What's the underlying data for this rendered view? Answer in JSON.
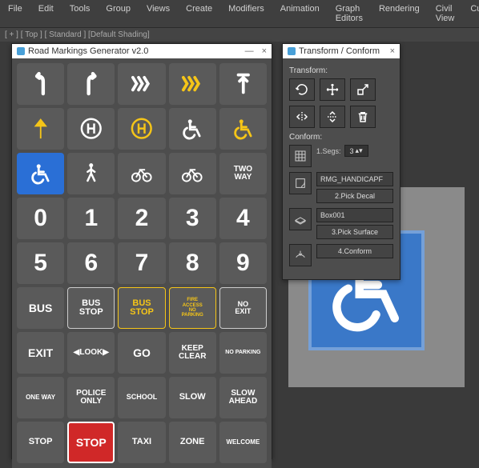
{
  "menu": {
    "items": [
      "File",
      "Edit",
      "Tools",
      "Group",
      "Views",
      "Create",
      "Modifiers",
      "Animation",
      "Graph Editors",
      "Rendering",
      "Civil View",
      "Customize"
    ]
  },
  "status_line": "[ + ] [ Top ] [ Standard ] [Default Shading]",
  "rm_panel": {
    "title": "Road Markings Generator v2.0",
    "minimize": "—",
    "close": "×",
    "tiles": [
      {
        "name": "arrow-left-turn",
        "kind": "svg",
        "svg": "arrL",
        "cls": ""
      },
      {
        "name": "arrow-right-turn",
        "kind": "svg",
        "svg": "arrR",
        "cls": ""
      },
      {
        "name": "chevrons-white",
        "kind": "svg",
        "svg": "chev",
        "cls": ""
      },
      {
        "name": "chevrons-yellow",
        "kind": "svg",
        "svg": "chev",
        "cls": "yellow"
      },
      {
        "name": "arrow-up-bar",
        "kind": "svg",
        "svg": "upbar",
        "cls": ""
      },
      {
        "name": "arrow-up-yellow",
        "kind": "svg",
        "svg": "upArrow",
        "cls": "yellow"
      },
      {
        "name": "helipad-white",
        "kind": "svg",
        "svg": "heli",
        "cls": ""
      },
      {
        "name": "helipad-yellow",
        "kind": "svg",
        "svg": "heli",
        "cls": "yellow"
      },
      {
        "name": "wheelchair-white",
        "kind": "svg",
        "svg": "wc",
        "cls": ""
      },
      {
        "name": "wheelchair-yellow",
        "kind": "svg",
        "svg": "wc",
        "cls": "yellow"
      },
      {
        "name": "wheelchair-blue",
        "kind": "svg",
        "svg": "wc",
        "cls": "blue"
      },
      {
        "name": "pedestrian",
        "kind": "svg",
        "svg": "ped",
        "cls": ""
      },
      {
        "name": "bicycle-up",
        "kind": "svg",
        "svg": "bike",
        "cls": ""
      },
      {
        "name": "bicycle",
        "kind": "svg",
        "svg": "bike",
        "cls": ""
      },
      {
        "name": "two-way",
        "kind": "text",
        "text": "TWO\nWAY",
        "cls": "small"
      },
      {
        "name": "digit-0",
        "kind": "text",
        "text": "0",
        "cls": "xbig"
      },
      {
        "name": "digit-1",
        "kind": "text",
        "text": "1",
        "cls": "xbig"
      },
      {
        "name": "digit-2",
        "kind": "text",
        "text": "2",
        "cls": "xbig"
      },
      {
        "name": "digit-3",
        "kind": "text",
        "text": "3",
        "cls": "xbig"
      },
      {
        "name": "digit-4",
        "kind": "text",
        "text": "4",
        "cls": "xbig"
      },
      {
        "name": "digit-5",
        "kind": "text",
        "text": "5",
        "cls": "xbig"
      },
      {
        "name": "digit-6",
        "kind": "text",
        "text": "6",
        "cls": "xbig"
      },
      {
        "name": "digit-7",
        "kind": "text",
        "text": "7",
        "cls": "xbig"
      },
      {
        "name": "digit-8",
        "kind": "text",
        "text": "8",
        "cls": "xbig"
      },
      {
        "name": "digit-9",
        "kind": "text",
        "text": "9",
        "cls": "xbig"
      },
      {
        "name": "bus",
        "kind": "text",
        "text": "BUS",
        "cls": ""
      },
      {
        "name": "bus-stop-white",
        "kind": "text",
        "text": "BUS\nSTOP",
        "cls": "busstop boxed"
      },
      {
        "name": "bus-stop-yellow",
        "kind": "text",
        "text": "BUS\nSTOP",
        "cls": "busstop stopyellow"
      },
      {
        "name": "fire-access",
        "kind": "text",
        "text": "FIRE\nACCESS\nNO\nPARKING",
        "cls": "stopyellow",
        "fs": "6"
      },
      {
        "name": "no-exit",
        "kind": "text",
        "text": "NO\nEXIT",
        "cls": "small boxed"
      },
      {
        "name": "exit",
        "kind": "text",
        "text": "EXIT",
        "cls": ""
      },
      {
        "name": "look",
        "kind": "text",
        "text": "◀LOOK▶",
        "cls": "small"
      },
      {
        "name": "go",
        "kind": "text",
        "text": "GO",
        "cls": ""
      },
      {
        "name": "keep-clear",
        "kind": "text",
        "text": "KEEP\nCLEAR",
        "cls": "small"
      },
      {
        "name": "no-parking",
        "kind": "text",
        "text": "NO PARKING",
        "cls": "small",
        "fs": "7"
      },
      {
        "name": "one-way",
        "kind": "text",
        "text": "ONE WAY",
        "cls": "small",
        "fs": "8"
      },
      {
        "name": "police-only",
        "kind": "text",
        "text": "POLICE\nONLY",
        "cls": "small"
      },
      {
        "name": "school",
        "kind": "text",
        "text": "SCHOOL",
        "cls": "small",
        "fs": "9"
      },
      {
        "name": "slow",
        "kind": "text",
        "text": "SLOW",
        "cls": "mid"
      },
      {
        "name": "slow-ahead",
        "kind": "text",
        "text": "SLOW\nAHEAD",
        "cls": "small"
      },
      {
        "name": "stop",
        "kind": "text",
        "text": "STOP",
        "cls": "mid"
      },
      {
        "name": "stop-red",
        "kind": "text",
        "text": "STOP",
        "cls": "stopred"
      },
      {
        "name": "taxi",
        "kind": "text",
        "text": "TAXI",
        "cls": "mid"
      },
      {
        "name": "zone",
        "kind": "text",
        "text": "ZONE",
        "cls": "mid"
      },
      {
        "name": "welcome",
        "kind": "text",
        "text": "WELCOME",
        "cls": "small",
        "fs": "8"
      }
    ]
  },
  "tf_panel": {
    "title": "Transform / Conform",
    "close": "×",
    "section_transform": "Transform:",
    "section_conform": "Conform:",
    "icons": {
      "rotate": "rotate-icon",
      "move": "move-icon",
      "scale": "scale-icon",
      "mirror_h": "mirror-horizontal-icon",
      "mirror_v": "mirror-vertical-icon",
      "delete": "trash-icon"
    },
    "segs_label": "1.Segs:",
    "segs_value": "3",
    "decal_name": "RMG_HANDICAPF",
    "pick_decal": "2.Pick Decal",
    "surface_name": "Box001",
    "pick_surface": "3.Pick Surface",
    "conform": "4.Conform"
  }
}
